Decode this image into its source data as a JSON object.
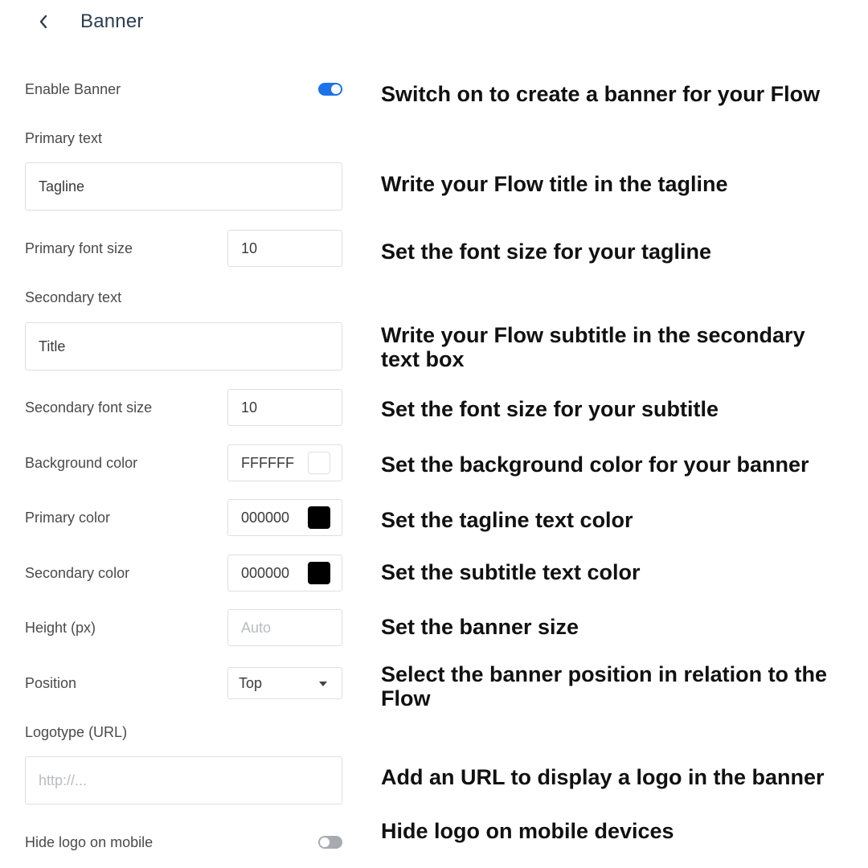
{
  "header": {
    "back_icon": "chevron-left-icon",
    "title": "Banner"
  },
  "colors": {
    "accent": "#1a73e8",
    "toggle_off": "#a7abb1",
    "swatch_white": "#FFFFFF",
    "swatch_black": "#000000"
  },
  "settings": {
    "enable_banner": {
      "label": "Enable Banner",
      "enabled": true
    },
    "primary_text": {
      "label": "Primary text",
      "value": "Tagline"
    },
    "primary_font_size": {
      "label": "Primary font size",
      "value": "10"
    },
    "secondary_text": {
      "label": "Secondary text",
      "value": "Title"
    },
    "secondary_font_size": {
      "label": "Secondary font size",
      "value": "10"
    },
    "background_color": {
      "label": "Background color",
      "value": "FFFFFF"
    },
    "primary_color": {
      "label": "Primary color",
      "value": "000000"
    },
    "secondary_color": {
      "label": "Secondary color",
      "value": "000000"
    },
    "height": {
      "label": "Height (px)",
      "value": "",
      "placeholder": "Auto"
    },
    "position": {
      "label": "Position",
      "value": "Top"
    },
    "logotype": {
      "label": "Logotype (URL)",
      "value": "",
      "placeholder": "http://..."
    },
    "hide_logo_mobile": {
      "label": "Hide logo on mobile",
      "enabled": false
    }
  },
  "annotations": {
    "enable_banner": "Switch on to create a banner for your Flow",
    "primary_text": "Write your Flow title in the tagline",
    "primary_font_size": "Set the font size for your tagline",
    "secondary_text": "Write your Flow subtitle in the secondary text box",
    "secondary_font_size": "Set the font size for your subtitle",
    "background_color": "Set the background color for your banner",
    "primary_color": "Set the tagline text color",
    "secondary_color": "Set the subtitle text color",
    "height": "Set the banner size",
    "position": "Select the banner position in relation to the Flow",
    "logotype": "Add an URL to display a logo in the banner",
    "hide_logo_mobile": "Hide logo on mobile devices"
  }
}
